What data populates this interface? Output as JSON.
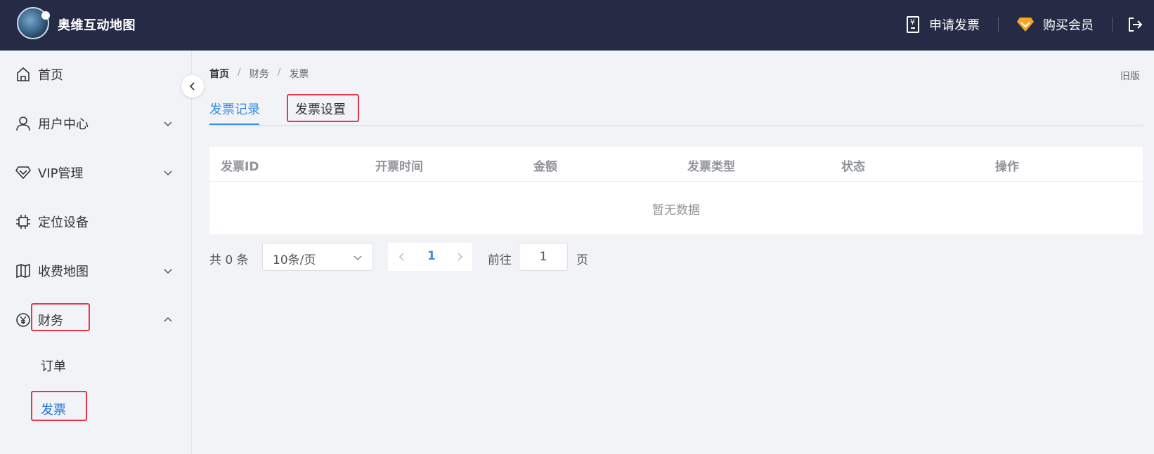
{
  "header": {
    "app_title": "奥维互动地图",
    "apply_invoice": "申请发票",
    "buy_vip": "购买会员",
    "colors": {
      "background": "#262b45",
      "vip_icon": "#f5a623"
    }
  },
  "sidebar": {
    "items": [
      {
        "label": "首页",
        "icon": "home-icon"
      },
      {
        "label": "用户中心",
        "icon": "user-icon"
      },
      {
        "label": "VIP管理",
        "icon": "diamond-icon"
      },
      {
        "label": "定位设备",
        "icon": "chip-icon"
      },
      {
        "label": "收费地图",
        "icon": "map-icon"
      },
      {
        "label": "财务",
        "icon": "yen-icon"
      }
    ],
    "finance_children": [
      {
        "label": "订单"
      },
      {
        "label": "发票",
        "active": true
      }
    ]
  },
  "breadcrumb": [
    "首页",
    "财务",
    "发票"
  ],
  "breadcrumb_sep": "/",
  "old_version": "旧版",
  "tabs": [
    {
      "label": "发票记录",
      "active": true
    },
    {
      "label": "发票设置",
      "active": false
    }
  ],
  "table": {
    "columns": [
      "发票ID",
      "开票时间",
      "金额",
      "发票类型",
      "状态",
      "操作"
    ],
    "empty_text": "暂无数据"
  },
  "pagination": {
    "total_text": "共 0 条",
    "page_size": "10条/页",
    "current_page": "1",
    "goto_label": "前往",
    "goto_value": "1",
    "page_suffix": "页"
  },
  "accent_color": "#3a8ee6",
  "highlight_color": "#e8364d"
}
